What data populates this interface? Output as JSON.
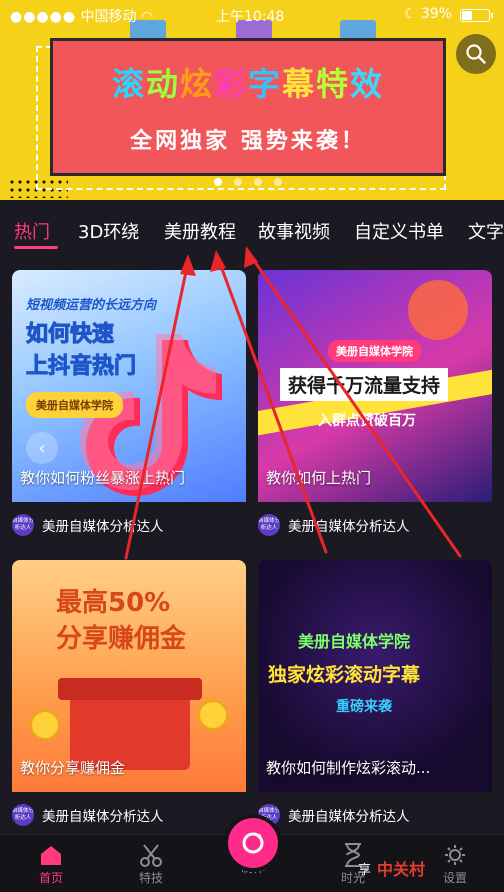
{
  "status_bar": {
    "carrier": "中国移动",
    "time": "上午10:48",
    "battery": "39%"
  },
  "banner": {
    "title": "滚动炫彩字幕特效",
    "title_chars": [
      "滚",
      "动",
      "炫",
      "彩",
      "字",
      "幕",
      "特",
      "效"
    ],
    "title_colors": [
      "#2ad4ff",
      "#9cff3a",
      "#ff9c1a",
      "#ff3ab8",
      "#36c1ff",
      "#ffe23a",
      "#b6ff35",
      "#3ad7ff"
    ],
    "subtitle": "全网独家  强势来袭！",
    "page_count": 4,
    "active_page": 1
  },
  "tabs": [
    "热门",
    "3D环绕",
    "美册教程",
    "故事视频",
    "自定义书单",
    "文字"
  ],
  "active_tab": 0,
  "cards": [
    {
      "caption": "教你如何粉丝暴涨上热门",
      "author": "美册自媒体分析达人",
      "overlay": {
        "line1": "短视频运营的长远方向",
        "line2": "如何快速",
        "line3": "上抖音热门",
        "badge": "美册自媒体学院"
      }
    },
    {
      "caption": "教你如何上热门",
      "author": "美册自媒体分析达人",
      "overlay": {
        "badge": "美册自媒体学院",
        "line1": "获得千万流量支持",
        "line2": "入群点赞破百万"
      }
    },
    {
      "caption": "教你分享赚佣金",
      "author": "美册自媒体分析达人",
      "overlay": {
        "line1": "最高50%",
        "line2": "分享赚佣金"
      }
    },
    {
      "caption": "教你如何制作炫彩滚动...",
      "author": "美册自媒体分析达人",
      "overlay": {
        "line1": "美册自媒体学院",
        "line2": "独家炫彩滚动字幕",
        "line3": "重磅来袭"
      }
    }
  ],
  "avatar_text": "自媒体分析达人",
  "bottom_nav": [
    {
      "label": "首页",
      "icon": "home-icon"
    },
    {
      "label": "特技",
      "icon": "scissors-icon"
    },
    {
      "label": "制作",
      "icon": "camera-icon"
    },
    {
      "label": "时光",
      "icon": "hourglass-icon"
    },
    {
      "label": "设置",
      "icon": "gear-icon"
    }
  ],
  "watermark": {
    "partial_text": "享",
    "brand": "中关村"
  },
  "colors": {
    "accent": "#ff3b7c",
    "banner_bg": "#f6d11a",
    "poster_red": "#f0565a",
    "background": "#1b1a22"
  }
}
